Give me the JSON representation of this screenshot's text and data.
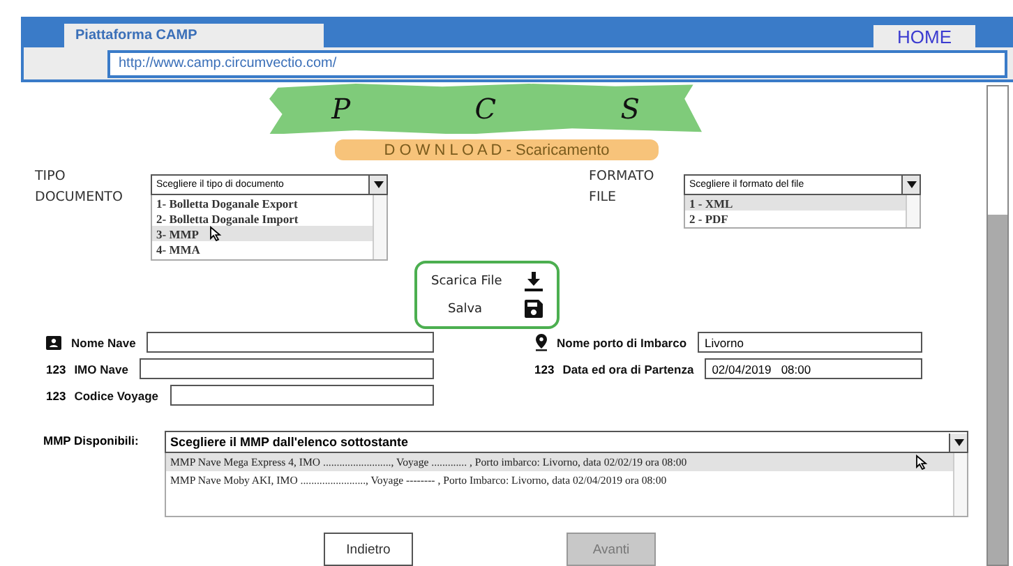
{
  "window": {
    "tab_title": "Piattaforma CAMP",
    "home_tab": "HOME",
    "url": "http://www.camp.circumvectio.com/"
  },
  "logo": {
    "letters": [
      "P",
      "C",
      "S"
    ],
    "subtitle": "D O W N L O A D - Scaricamento"
  },
  "tipo_documento": {
    "label_lines": [
      "TIPO",
      "DOCUMENTO"
    ],
    "value": "Scegliere il tipo di documento",
    "options": [
      {
        "label": "1- Bolletta Doganale Export",
        "selected": false,
        "hovered": false
      },
      {
        "label": "2- Bolletta Doganale Import",
        "selected": false,
        "hovered": false
      },
      {
        "label": "3- MMP",
        "selected": true,
        "hovered": true
      },
      {
        "label": "4- MMA",
        "selected": false,
        "hovered": false
      }
    ]
  },
  "formato_file": {
    "label_lines": [
      "FORMATO",
      "FILE"
    ],
    "value": "Scegliere il formato del file",
    "options": [
      {
        "label": "1 - XML",
        "selected": true,
        "hovered": false
      },
      {
        "label": "2 - PDF",
        "selected": false,
        "hovered": false
      }
    ]
  },
  "actions": [
    {
      "label": "Scarica File",
      "kind": "download"
    },
    {
      "label": "Salva",
      "kind": "save"
    }
  ],
  "fields_left": [
    {
      "kind": "person",
      "label": "Nome Nave"
    },
    {
      "kind": "number",
      "prefix": "123",
      "label": "IMO Nave"
    },
    {
      "kind": "number",
      "prefix": "123",
      "label": "Codice Voyage"
    }
  ],
  "fields_right": [
    {
      "kind": "pin",
      "label": "Nome porto di Imbarco",
      "value": "Livorno"
    },
    {
      "kind": "number",
      "prefix": "123",
      "label": "Data ed ora di Partenza",
      "value": "02/04/2019   08:00"
    }
  ],
  "mmp": {
    "label": "MMP Disponibili:",
    "value": "Scegliere il MMP dall'elenco sottostante",
    "options": [
      {
        "label": "MMP Nave Mega Express 4, IMO ........................., Voyage ............. , Porto imbarco: Livorno,  data 02/02/19 ora 08:00",
        "selected": true,
        "hovered": true
      },
      {
        "label": "MMP Nave Moby AKI, IMO ........................, Voyage -------- , Porto Imbarco: Livorno, data 02/04/2019  ora 08:00",
        "selected": false,
        "hovered": false
      }
    ]
  },
  "buttons": [
    {
      "label": "Indietro",
      "disabled": false
    },
    {
      "label": "Avanti",
      "disabled": true
    }
  ]
}
